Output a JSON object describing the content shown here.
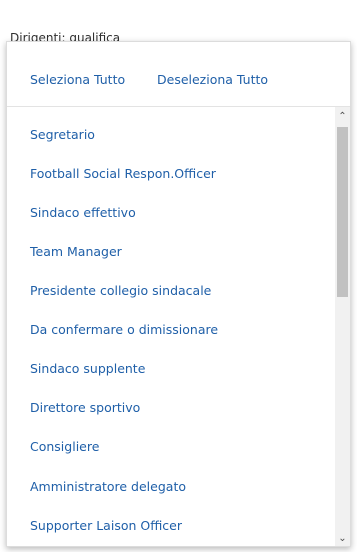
{
  "header": {
    "label": "Dirigenti: qualifica"
  },
  "actions": {
    "select_all": "Seleziona Tutto",
    "deselect_all": "Deseleziona Tutto"
  },
  "items": [
    "Segretario",
    "Football Social Respon.Officer",
    "Sindaco effettivo",
    "Team Manager",
    "Presidente collegio sindacale",
    "Da confermare o dimissionare",
    "Sindaco supplente",
    "Direttore sportivo",
    "Consigliere",
    "Amministratore delegato",
    "Supporter Laison Officer"
  ],
  "scrollbar": {
    "up_icon": "chevron-up-icon",
    "down_icon": "chevron-down-icon"
  },
  "colors": {
    "link": "#1f5fa8",
    "label": "#2f2f2f"
  }
}
